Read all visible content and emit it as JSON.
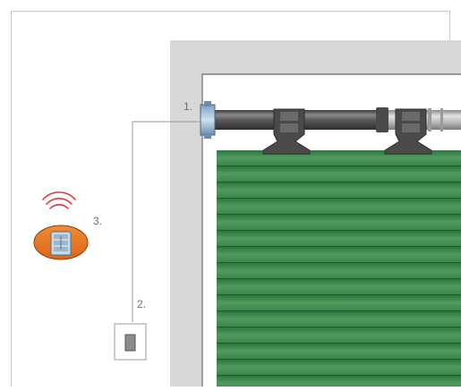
{
  "labels": {
    "tube_motor": "1.",
    "wall_switch": "2.",
    "remote": "3."
  },
  "colors": {
    "frame": "#d6d6d6",
    "frame_line": "#7d7d7d",
    "slat_green": "#3f8f4f",
    "slat_dark": "#2b6f3b",
    "tube": "#5f5f5f",
    "remote_orange": "#ee7b27",
    "signal_red": "#e53438",
    "switch_grey": "#8c8c8c"
  },
  "icons": [
    "signal-waves-icon",
    "remote-control-icon",
    "wall-switch-icon"
  ]
}
